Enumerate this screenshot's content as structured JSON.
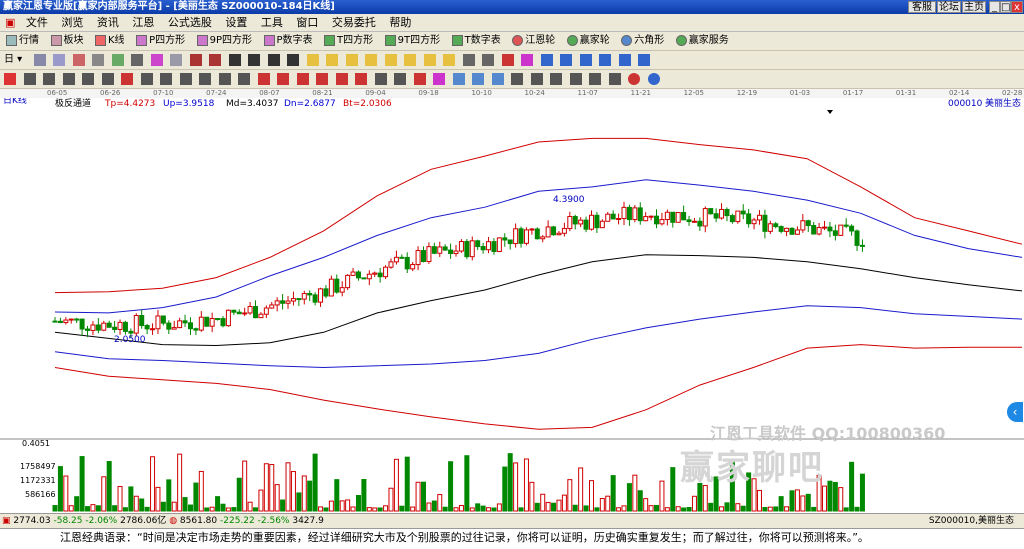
{
  "window": {
    "title": "赢家江恩专业版[赢家内部服务平台] - [美丽生态   SZ000010-184日K线]",
    "buttons": [
      "客服",
      "论坛",
      "主页",
      "_",
      "□",
      "x"
    ]
  },
  "menu": [
    "文件",
    "浏览",
    "资讯",
    "江恩",
    "公式选股",
    "设置",
    "工具",
    "窗口",
    "交易委托",
    "帮助"
  ],
  "toolbar1": [
    "行情",
    "板块",
    "K线",
    "P四方形",
    "9P四方形",
    "P数字表",
    "T四方形",
    "9T四方形",
    "T数字表",
    "江恩轮",
    "赢家轮",
    "六角形",
    "赢家服务"
  ],
  "toolbar2": {
    "period": "日"
  },
  "date_ticks": [
    "06-05",
    "06-26",
    "07-10",
    "07-24",
    "08-07",
    "08-21",
    "09-04",
    "09-18",
    "10-10",
    "10-24",
    "11-07",
    "11-21",
    "12-05",
    "12-19",
    "01-03",
    "01-17",
    "01-31",
    "02-14",
    "02-28"
  ],
  "chart": {
    "period_label": "日K线",
    "indicator": "极反通道",
    "params": [
      {
        "label": "Tp=4.4273",
        "color": "#d00000"
      },
      {
        "label": "Up=3.9518",
        "color": "#0000d0"
      },
      {
        "label": "Md=3.4037",
        "color": "#000000"
      },
      {
        "label": "Dn=2.6877",
        "color": "#0000d0"
      },
      {
        "label": "Bt=2.0306",
        "color": "#d00000"
      }
    ],
    "stock_code": "000010",
    "stock_name": "美丽生态",
    "high_label": "4.3900",
    "low_label": "2.0500",
    "volume_max_label": "0.4051",
    "volume_ticks": [
      "1758497",
      "1172331",
      "586166"
    ]
  },
  "chart_data": {
    "type": "candlestick",
    "title": "美丽生态 000010 日K线",
    "x": [
      "06-05",
      "06-26",
      "07-10",
      "07-24",
      "08-07",
      "08-21",
      "09-04",
      "09-18",
      "10-10",
      "10-24",
      "11-07",
      "11-21",
      "12-05",
      "12-19",
      "01-03",
      "01-17",
      "01-31",
      "02-14",
      "02-28"
    ],
    "series": [
      {
        "name": "Tp",
        "values": [
          2.65,
          2.66,
          2.7,
          2.82,
          3.05,
          3.35,
          3.75,
          4.05,
          4.2,
          4.36,
          4.4,
          4.4,
          4.33,
          4.27,
          4.17,
          3.85,
          3.5,
          3.35,
          3.2
        ]
      },
      {
        "name": "Up",
        "values": [
          2.43,
          2.42,
          2.48,
          2.6,
          2.84,
          3.05,
          3.3,
          3.5,
          3.62,
          3.8,
          3.85,
          3.93,
          3.87,
          3.8,
          3.7,
          3.55,
          3.3,
          3.15,
          3.05
        ]
      },
      {
        "name": "Md",
        "values": [
          2.2,
          2.13,
          2.06,
          2.05,
          2.08,
          2.2,
          2.42,
          2.56,
          2.68,
          2.85,
          3.0,
          3.08,
          3.07,
          3.05,
          3.0,
          2.92,
          2.82,
          2.74,
          2.67
        ]
      },
      {
        "name": "Dn",
        "values": [
          1.98,
          1.9,
          1.88,
          1.85,
          1.82,
          1.8,
          1.82,
          1.84,
          1.88,
          1.96,
          2.12,
          2.25,
          2.35,
          2.43,
          2.5,
          2.48,
          2.41,
          2.38,
          2.35
        ]
      },
      {
        "name": "Bt",
        "values": [
          1.8,
          1.7,
          1.66,
          1.62,
          1.55,
          1.43,
          1.33,
          1.24,
          1.16,
          1.1,
          1.12,
          1.32,
          1.6,
          1.8,
          2.02,
          2.06,
          2.02,
          2.03,
          2.03
        ]
      }
    ],
    "price_high": 4.39,
    "price_low": 2.05,
    "ylim": [
      1.0,
      4.7
    ]
  },
  "statusbar": {
    "sh": "2774.03",
    "sh_chg": "-58.25",
    "sh_pct": "-2.06%",
    "sh_amt": "2786.06亿",
    "sz": "8561.80",
    "sz_chg": "-225.22",
    "sz_pct": "-2.56%",
    "sz_amt": "3427.9",
    "right": "SZ000010,美丽生态"
  },
  "quote": "江恩经典语录：“时间是决定市场走势的重要因素，经过详细研究大市及个别股票的过往记录，你将可以证明，历史确实重复发生；而了解过往，你将可以预测将来。”。",
  "watermark": {
    "line1": "江恩工具软件  QQ:100800360",
    "line2": "赢家聊吧"
  }
}
